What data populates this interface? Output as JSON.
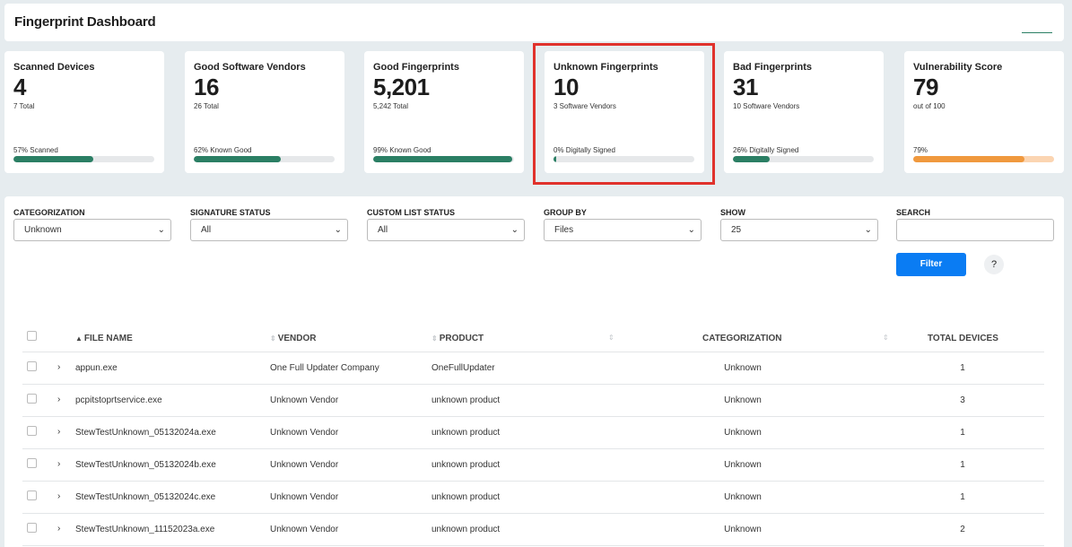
{
  "header": {
    "title": "Fingerprint Dashboard"
  },
  "cards": [
    {
      "title": "Scanned Devices",
      "value": "4",
      "sub": "7 Total",
      "bar_label": "57% Scanned",
      "progress": 0.57
    },
    {
      "title": "Good Software Vendors",
      "value": "16",
      "sub": "26 Total",
      "bar_label": "62% Known Good",
      "progress": 0.62
    },
    {
      "title": "Good Fingerprints",
      "value": "5,201",
      "sub": "5,242 Total",
      "bar_label": "99% Known Good",
      "progress": 0.99
    },
    {
      "title": "Unknown Fingerprints",
      "value": "10",
      "sub": "3 Software Vendors",
      "bar_label": "0% Digitally Signed",
      "progress": 0.02
    },
    {
      "title": "Bad Fingerprints",
      "value": "31",
      "sub": "10 Software Vendors",
      "bar_label": "26% Digitally Signed",
      "progress": 0.26
    },
    {
      "title": "Vulnerability Score",
      "value": "79",
      "sub": "out of 100",
      "bar_label": "79%",
      "progress": 0.79
    }
  ],
  "filters": {
    "categorization": {
      "label": "CATEGORIZATION",
      "value": "Unknown"
    },
    "signature_status": {
      "label": "SIGNATURE STATUS",
      "value": "All"
    },
    "custom_list_status": {
      "label": "CUSTOM LIST STATUS",
      "value": "All"
    },
    "group_by": {
      "label": "GROUP BY",
      "value": "Files"
    },
    "show": {
      "label": "SHOW",
      "value": "25"
    },
    "search": {
      "label": "SEARCH",
      "value": ""
    },
    "filter_button": "Filter",
    "help_button": "?"
  },
  "table": {
    "columns": [
      "FILE NAME",
      "VENDOR",
      "PRODUCT",
      "CATEGORIZATION",
      "TOTAL DEVICES"
    ],
    "rows": [
      {
        "file": "appun.exe",
        "vendor": "One Full Updater Company",
        "product": "OneFullUpdater",
        "categorization": "Unknown",
        "devices": "1"
      },
      {
        "file": "pcpitstoprtservice.exe",
        "vendor": "Unknown Vendor",
        "product": "unknown product",
        "categorization": "Unknown",
        "devices": "3"
      },
      {
        "file": "StewTestUnknown_05132024a.exe",
        "vendor": "Unknown Vendor",
        "product": "unknown product",
        "categorization": "Unknown",
        "devices": "1"
      },
      {
        "file": "StewTestUnknown_05132024b.exe",
        "vendor": "Unknown Vendor",
        "product": "unknown product",
        "categorization": "Unknown",
        "devices": "1"
      },
      {
        "file": "StewTestUnknown_05132024c.exe",
        "vendor": "Unknown Vendor",
        "product": "unknown product",
        "categorization": "Unknown",
        "devices": "1"
      },
      {
        "file": "StewTestUnknown_11152023a.exe",
        "vendor": "Unknown Vendor",
        "product": "unknown product",
        "categorization": "Unknown",
        "devices": "2"
      }
    ]
  },
  "colors": {
    "accent_green": "#2b7f64",
    "highlight_red": "#e0322c",
    "button_blue": "#0a7cf3",
    "vuln_orange": "#f0993e"
  }
}
